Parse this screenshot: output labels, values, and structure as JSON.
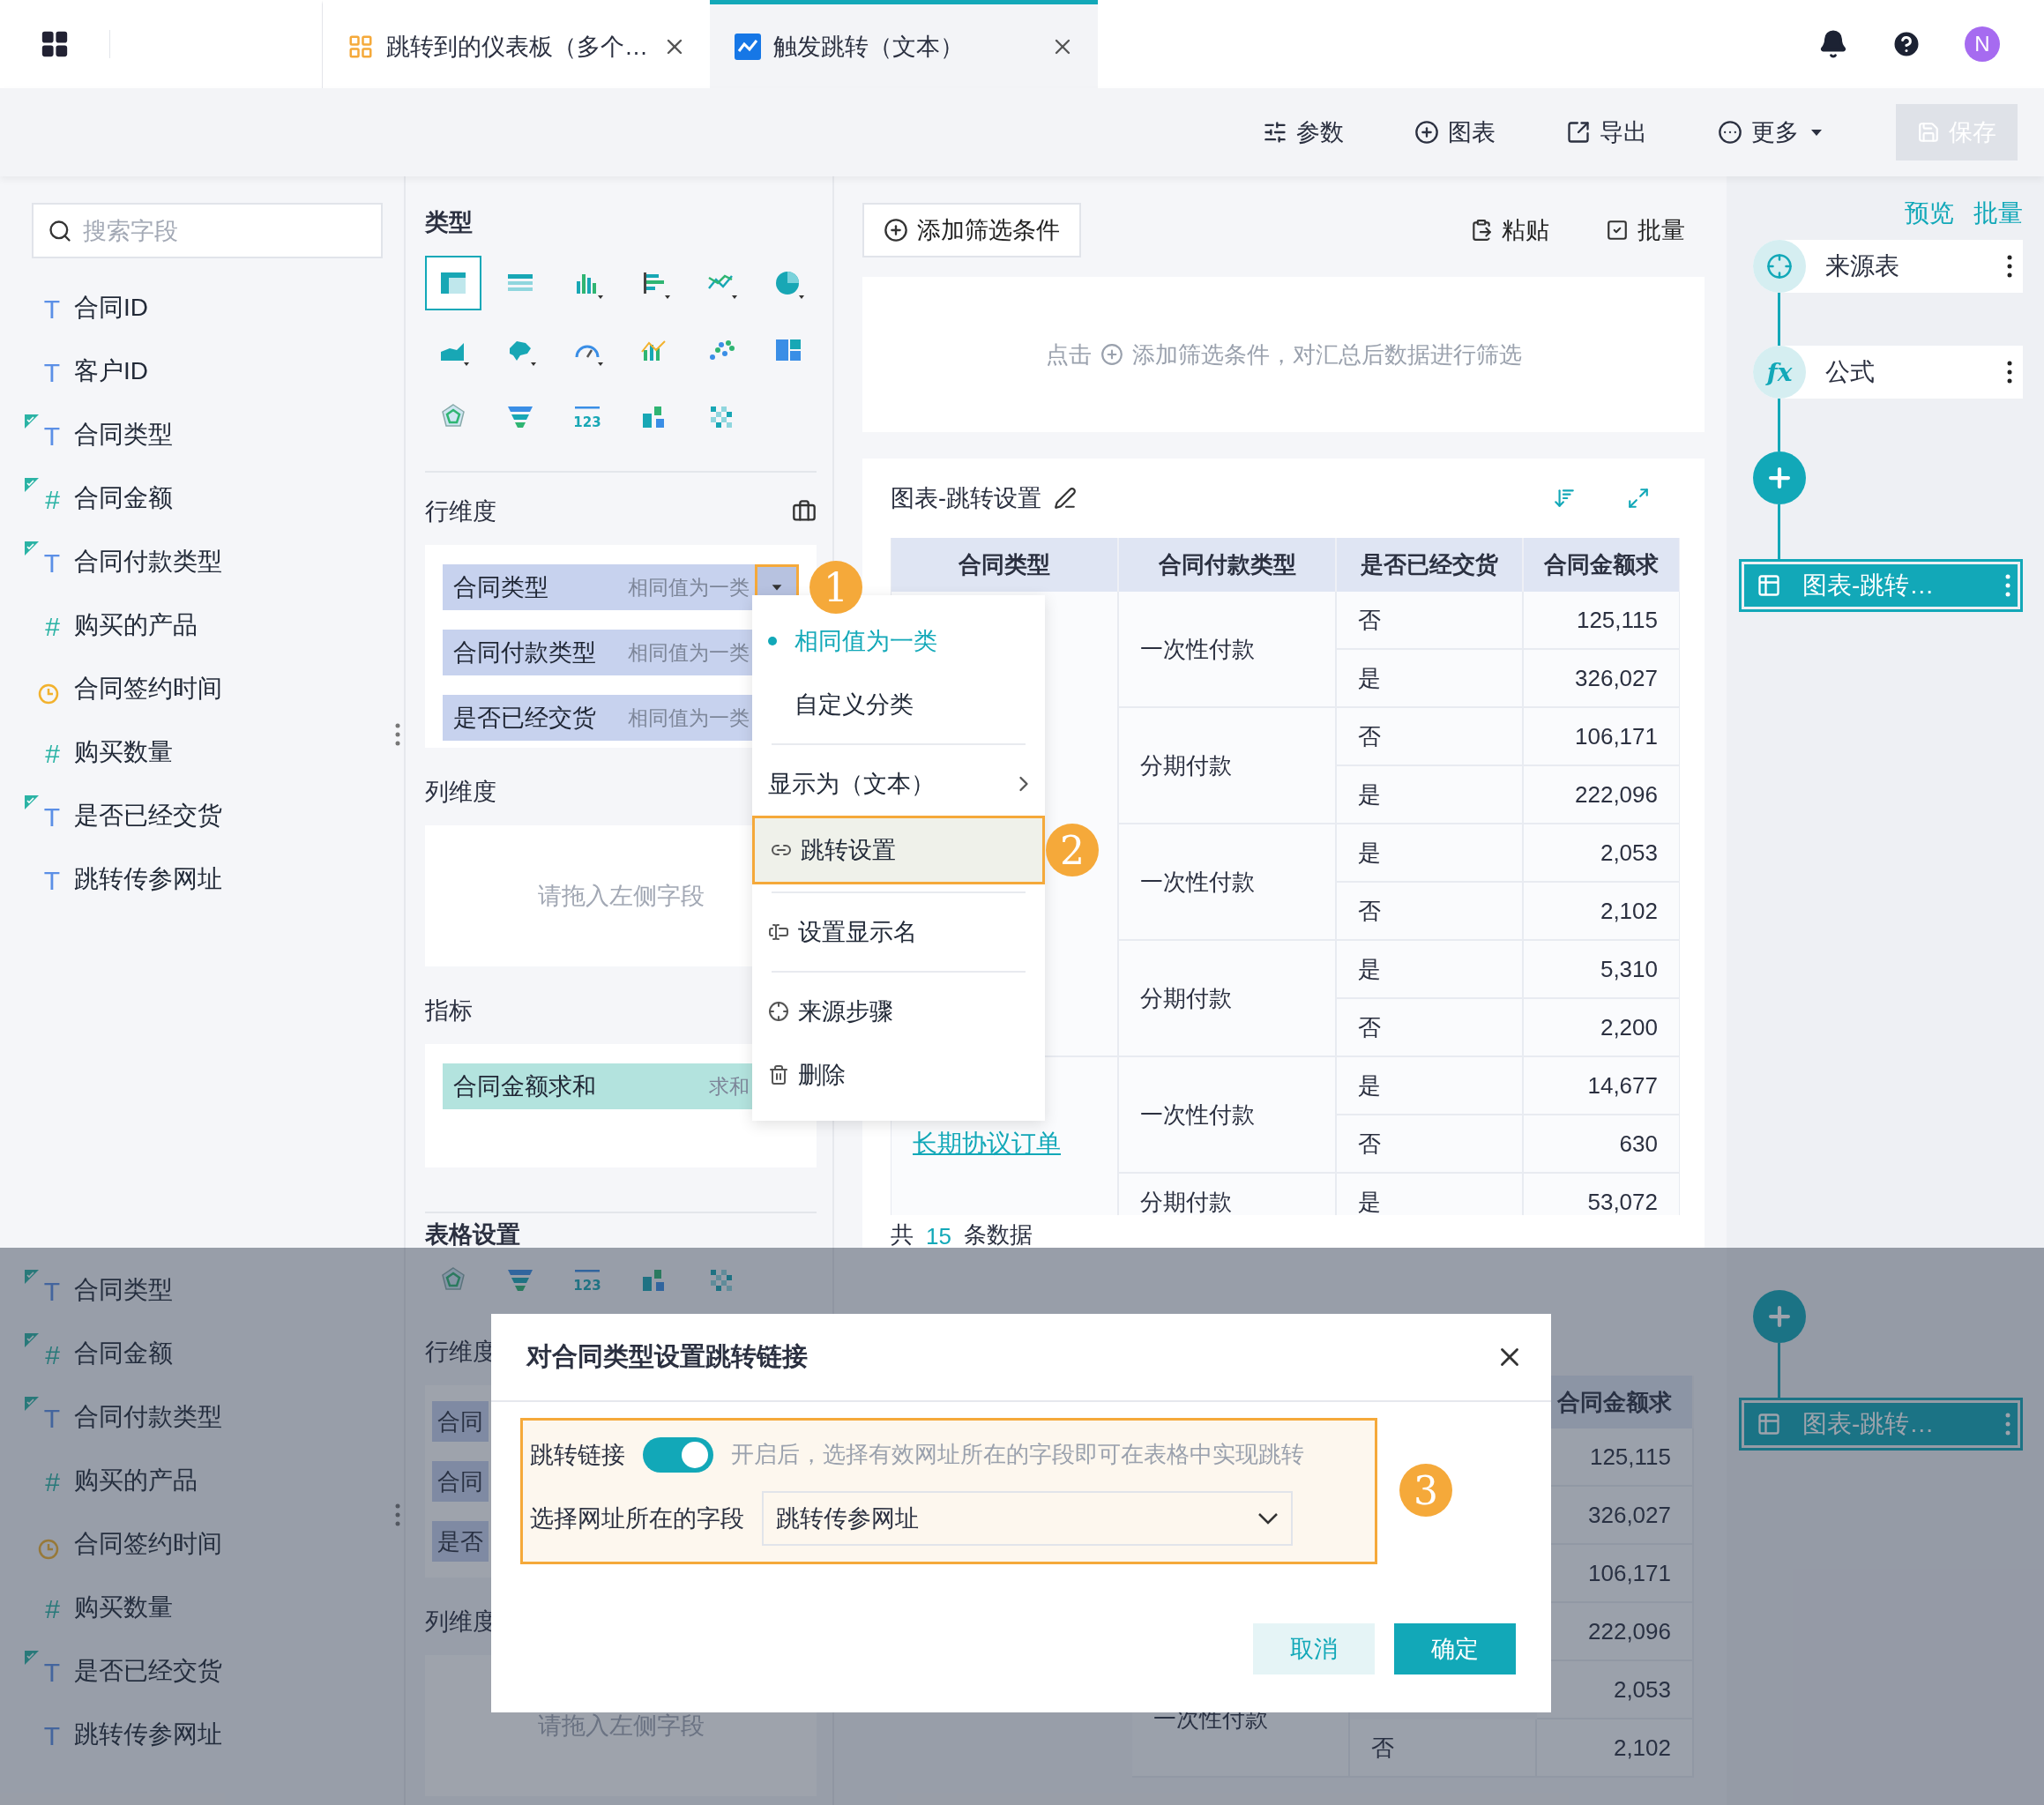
{
  "tab_bar": {
    "tabs": [
      {
        "title": "跳转到的仪表板（多个…",
        "kind": "dashboard",
        "selected": false
      },
      {
        "title": "触发跳转（文本）",
        "kind": "chart",
        "selected": true
      }
    ],
    "avatar": "N"
  },
  "toolbar": {
    "buttons": [
      {
        "label": "参数",
        "kind": "param"
      },
      {
        "label": "图表",
        "kind": "add"
      },
      {
        "label": "导出",
        "kind": "export"
      },
      {
        "label": "更多",
        "kind": "more"
      }
    ],
    "save": {
      "label": "保存",
      "disabled": true
    }
  },
  "fields_panel": {
    "search_placeholder": "搜索字段",
    "fields": [
      {
        "name": "合同ID",
        "kind": "text",
        "glyph": "T",
        "linked": false
      },
      {
        "name": "客户ID",
        "kind": "text",
        "glyph": "T",
        "linked": false
      },
      {
        "name": "合同类型",
        "kind": "text",
        "glyph": "T",
        "linked": true
      },
      {
        "name": "合同金额",
        "kind": "number",
        "glyph": "#",
        "linked": true
      },
      {
        "name": "合同付款类型",
        "kind": "text",
        "glyph": "T",
        "linked": true
      },
      {
        "name": "购买的产品",
        "kind": "number",
        "glyph": "#",
        "linked": false
      },
      {
        "name": "合同签约时间",
        "kind": "date",
        "linked": false
      },
      {
        "name": "购买数量",
        "kind": "number",
        "glyph": "#",
        "linked": false
      },
      {
        "name": "是否已经交货",
        "kind": "text",
        "glyph": "T",
        "linked": true
      },
      {
        "name": "跳转传参网址",
        "kind": "text",
        "glyph": "T",
        "linked": false
      }
    ]
  },
  "config_panel": {
    "type_title": "类型",
    "chart_types": [
      {
        "kind": "table-detail",
        "selected": true
      },
      {
        "kind": "table-cross",
        "selected": false
      },
      {
        "kind": "bar",
        "selected": false,
        "variants": true
      },
      {
        "kind": "hbar",
        "selected": false,
        "variants": true
      },
      {
        "kind": "line",
        "selected": false,
        "variants": true
      },
      {
        "kind": "pie",
        "selected": false,
        "variants": true
      },
      {
        "kind": "area",
        "selected": false,
        "variants": true
      },
      {
        "kind": "map",
        "selected": false,
        "variants": true
      },
      {
        "kind": "gauge",
        "selected": false,
        "variants": true
      },
      {
        "kind": "combo",
        "selected": false
      },
      {
        "kind": "scatter",
        "selected": false
      },
      {
        "kind": "treemap",
        "selected": false
      },
      {
        "kind": "radar",
        "selected": false
      },
      {
        "kind": "funnel",
        "selected": false
      },
      {
        "kind": "kpi",
        "selected": false,
        "glyph": "123"
      },
      {
        "kind": "wordcloud",
        "selected": false
      },
      {
        "kind": "heatmap",
        "selected": false
      }
    ],
    "row_dim": {
      "title": "行维度",
      "pills": [
        {
          "name": "合同类型",
          "mode": "相同值为一类",
          "menu_open": true,
          "step": "1"
        },
        {
          "name": "合同付款类型",
          "mode": "相同值为一类",
          "menu_open": false
        },
        {
          "name": "是否已经交货",
          "mode": "相同值为一类",
          "menu_open": false
        }
      ]
    },
    "col_dim": {
      "title": "列维度",
      "placeholder": "请拖入左侧字段"
    },
    "metrics": {
      "title": "指标",
      "pills": [
        {
          "name": "合同金额求和",
          "mode": "求和"
        }
      ]
    },
    "next_section": "表格设置"
  },
  "context_menu": {
    "groups": [
      [
        {
          "label": "相同值为一类",
          "kind": "option",
          "selected": true
        },
        {
          "label": "自定义分类",
          "kind": "option",
          "selected": false
        }
      ],
      [
        {
          "label": "显示为（文本）",
          "kind": "submenu"
        },
        {
          "label": "跳转设置",
          "kind": "jump",
          "highlighted": true,
          "step": "2"
        }
      ],
      [
        {
          "label": "设置显示名",
          "kind": "rename"
        }
      ],
      [
        {
          "label": "来源步骤",
          "kind": "source"
        },
        {
          "label": "删除",
          "kind": "delete"
        }
      ]
    ]
  },
  "filter_bar": {
    "add_label": "添加筛选条件",
    "actions": [
      {
        "label": "粘贴",
        "kind": "paste"
      },
      {
        "label": "批量",
        "kind": "batch"
      }
    ],
    "hint_prefix": "点击",
    "hint_text": "添加筛选条件，对汇总后数据进行筛选"
  },
  "chart_card": {
    "title": "图表-跳转设置",
    "columns": [
      "合同类型",
      "合同付款类型",
      "是否已经交货",
      "合同金额求"
    ],
    "type_groups": [
      {
        "payments": [
          {
            "label": "一次性付款",
            "rows": [
              {
                "delivered": "否",
                "amount": "125,115"
              },
              {
                "delivered": "是",
                "amount": "326,027"
              }
            ]
          },
          {
            "label": "分期付款",
            "rows": [
              {
                "delivered": "否",
                "amount": "106,171"
              },
              {
                "delivered": "是",
                "amount": "222,096"
              }
            ]
          },
          {
            "label": "一次性付款",
            "rows": [
              {
                "delivered": "是",
                "amount": "2,053"
              },
              {
                "delivered": "否",
                "amount": "2,102"
              }
            ]
          },
          {
            "label": "分期付款",
            "rows": [
              {
                "delivered": "是",
                "amount": "5,310"
              },
              {
                "delivered": "否",
                "amount": "2,200"
              }
            ]
          }
        ]
      },
      {
        "label": "长期协议订单",
        "payments": [
          {
            "label": "一次性付款",
            "rows": [
              {
                "delivered": "是",
                "amount": "14,677"
              },
              {
                "delivered": "否",
                "amount": "630"
              }
            ]
          },
          {
            "label": "分期付款",
            "rows": [
              {
                "delivered": "是",
                "amount": "53,072"
              }
            ]
          }
        ]
      }
    ],
    "footer": {
      "prefix": "共",
      "count": "15",
      "suffix": "条数据"
    }
  },
  "flow_panel": {
    "links": [
      "预览",
      "批量"
    ],
    "nodes": [
      {
        "label": "来源表",
        "kind": "source"
      },
      {
        "label": "公式",
        "kind": "formula",
        "glyph": "fx"
      },
      {
        "kind": "add"
      },
      {
        "label": "图表-跳转…",
        "kind": "chart",
        "selected": true
      }
    ]
  },
  "background_view": {
    "fields": [
      {
        "name": "合同类型",
        "kind": "text",
        "glyph": "T",
        "linked": true
      },
      {
        "name": "合同金额",
        "kind": "number",
        "glyph": "#",
        "linked": true
      },
      {
        "name": "合同付款类型",
        "kind": "text",
        "glyph": "T",
        "linked": true
      },
      {
        "name": "购买的产品",
        "kind": "number",
        "glyph": "#",
        "linked": false
      },
      {
        "name": "合同签约时间",
        "kind": "date",
        "linked": false
      },
      {
        "name": "购买数量",
        "kind": "number",
        "glyph": "#",
        "linked": false
      },
      {
        "name": "是否已经交货",
        "kind": "text",
        "glyph": "T",
        "linked": true
      },
      {
        "name": "跳转传参网址",
        "kind": "text",
        "glyph": "T",
        "linked": false
      }
    ],
    "chart_types": [
      {
        "kind": "radar",
        "selected": false
      },
      {
        "kind": "funnel",
        "selected": false
      },
      {
        "kind": "kpi",
        "selected": false,
        "glyph": "123"
      },
      {
        "kind": "wordcloud",
        "selected": false
      },
      {
        "kind": "heatmap",
        "selected": false
      }
    ],
    "row_dim_title": "行维度",
    "pills": [
      "合同",
      "合同",
      "是否"
    ],
    "col_dim_title": "列维度",
    "placeholder": "请拖入左侧字段",
    "table": {
      "header": "合同金额求",
      "rows": [
        {
          "amount": "125,115"
        },
        {
          "amount": "326,027"
        },
        {
          "amount": "106,171"
        },
        {
          "amount": "222,096"
        },
        {
          "payment": "一次性付款",
          "amount": "2,053"
        },
        {
          "delivered": "否",
          "amount": "2,102"
        }
      ]
    },
    "node": {
      "label": "图表-跳转…"
    }
  },
  "dialog": {
    "title": "对合同类型设置跳转链接",
    "step": "3",
    "toggle": {
      "label": "跳转链接",
      "on": true,
      "hint": "开启后，选择有效网址所在的字段即可在表格中实现跳转"
    },
    "select": {
      "label": "选择网址所在的字段",
      "value": "跳转传参网址"
    },
    "buttons": [
      {
        "label": "取消",
        "kind": "secondary"
      },
      {
        "label": "确定",
        "kind": "primary"
      }
    ]
  }
}
